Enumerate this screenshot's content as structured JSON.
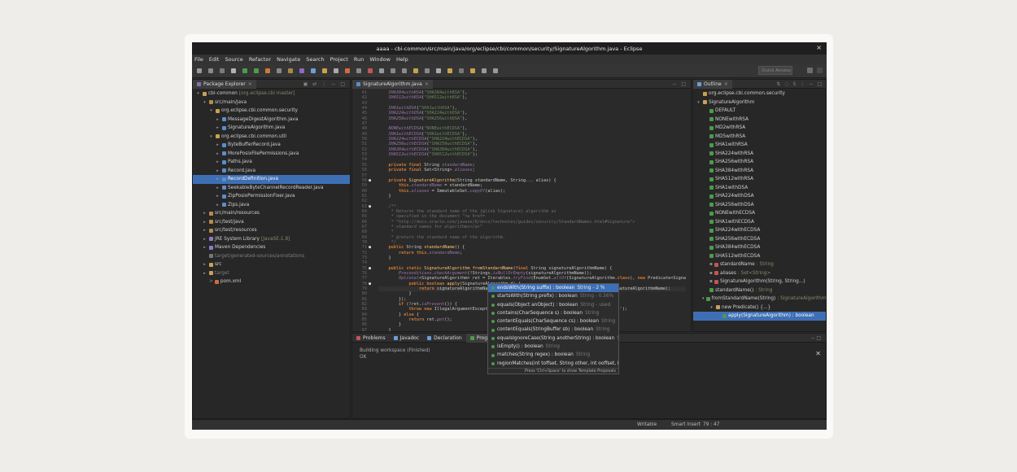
{
  "window_title": "aaaa - cbi-common/src/main/java/org/eclipse/cbi/common/security/SignatureAlgorithm.java - Eclipse",
  "menu": [
    "File",
    "Edit",
    "Source",
    "Refactor",
    "Navigate",
    "Search",
    "Project",
    "Run",
    "Window",
    "Help"
  ],
  "quick_access": "Quick Access",
  "package_explorer": {
    "tab": "Package Explorer",
    "items": [
      {
        "label": "cbi-common",
        "deco": "[org.eclipse.cbi master]",
        "indent": 0,
        "arrow": "▾",
        "icon": "#c9a05a"
      },
      {
        "label": "src/main/java",
        "indent": 1,
        "arrow": "▾",
        "icon": "#b58b4c"
      },
      {
        "label": "org.eclipse.cbi.common.security",
        "indent": 2,
        "arrow": "▾",
        "icon": "#c8a24a"
      },
      {
        "label": "MessageDigestAlgorithm.java",
        "indent": 3,
        "arrow": "▸",
        "icon": "#5b8ec9"
      },
      {
        "label": "SignatureAlgorithm.java",
        "indent": 3,
        "arrow": "▸",
        "icon": "#5b8ec9"
      },
      {
        "label": "org.eclipse.cbi.common.util",
        "indent": 2,
        "arrow": "▾",
        "icon": "#c8a24a"
      },
      {
        "label": "ByteBufferRecord.java",
        "indent": 3,
        "arrow": "▸",
        "icon": "#5b8ec9"
      },
      {
        "label": "MorePosixFilePermissions.java",
        "indent": 3,
        "arrow": "▸",
        "icon": "#5b8ec9"
      },
      {
        "label": "Paths.java",
        "indent": 3,
        "arrow": "▸",
        "icon": "#5b8ec9"
      },
      {
        "label": "Record.java",
        "indent": 3,
        "arrow": "▸",
        "icon": "#5b8ec9"
      },
      {
        "label": "RecordDefinition.java",
        "indent": 3,
        "arrow": "▸",
        "icon": "#5b8ec9",
        "selected": true
      },
      {
        "label": "SeekableByteChannelRecordReader.java",
        "indent": 3,
        "arrow": "▸",
        "icon": "#5b8ec9"
      },
      {
        "label": "ZipPosixPermissionFixer.java",
        "indent": 3,
        "arrow": "▸",
        "icon": "#5b8ec9"
      },
      {
        "label": "Zips.java",
        "indent": 3,
        "arrow": "▸",
        "icon": "#5b8ec9"
      },
      {
        "label": "src/main/resources",
        "indent": 1,
        "arrow": "▸",
        "icon": "#b58b4c"
      },
      {
        "label": "src/test/java",
        "indent": 1,
        "arrow": "▸",
        "icon": "#b58b4c"
      },
      {
        "label": "src/test/resources",
        "indent": 1,
        "arrow": "▸",
        "icon": "#b58b4c"
      },
      {
        "label": "JRE System Library",
        "deco": "[JavaSE-1.8]",
        "indent": 1,
        "arrow": "▸",
        "icon": "#8a7cc2"
      },
      {
        "label": "Maven Dependencies",
        "indent": 1,
        "arrow": "▸",
        "icon": "#8a7cc2"
      },
      {
        "label": "target/generated-sources/annotations",
        "indent": 1,
        "arrow": "",
        "icon": "#777",
        "dim": true
      },
      {
        "label": "src",
        "indent": 1,
        "arrow": "▸",
        "icon": "#c9a05a"
      },
      {
        "label": "target",
        "indent": 1,
        "arrow": "▸",
        "icon": "#c9a05a",
        "dim": true
      },
      {
        "label": "pom.xml",
        "indent": 1,
        "arrow": "",
        "icon": "#d26b3c",
        "prefix": "> "
      }
    ]
  },
  "editor": {
    "tab": "SignatureAlgorithm.java",
    "lines": [
      {
        "n": "41",
        "h": "\t<span class=\"f\">SHA384withRSA</span>(<span class=\"s\">\"SHA384withRSA\"</span>),"
      },
      {
        "n": "42",
        "h": "\t<span class=\"f\">SHA512withRSA</span>(<span class=\"s\">\"SHA512withRSA\"</span>),"
      },
      {
        "n": "43",
        "h": ""
      },
      {
        "n": "44",
        "h": "\t<span class=\"f\">SHA1withDSA</span>(<span class=\"s\">\"SHA1withDSA\"</span>),"
      },
      {
        "n": "45",
        "h": "\t<span class=\"f\">SHA224withDSA</span>(<span class=\"s\">\"SHA224withDSA\"</span>),"
      },
      {
        "n": "46",
        "h": "\t<span class=\"f\">SHA256withDSA</span>(<span class=\"s\">\"SHA256withDSA\"</span>),"
      },
      {
        "n": "47",
        "h": ""
      },
      {
        "n": "48",
        "h": "\t<span class=\"f\">NONEwithECDSA</span>(<span class=\"s\">\"NONEwithECDSA\"</span>),"
      },
      {
        "n": "49",
        "h": "\t<span class=\"f\">SHA1withECDSA</span>(<span class=\"s\">\"SHA1withECDSA\"</span>),"
      },
      {
        "n": "50",
        "h": "\t<span class=\"f\">SHA224withECDSA</span>(<span class=\"s\">\"SHA224withECDSA\"</span>),"
      },
      {
        "n": "51",
        "h": "\t<span class=\"f\">SHA256withECDSA</span>(<span class=\"s\">\"SHA256withECDSA\"</span>),"
      },
      {
        "n": "52",
        "h": "\t<span class=\"f\">SHA384withECDSA</span>(<span class=\"s\">\"SHA384withECDSA\"</span>),"
      },
      {
        "n": "53",
        "h": "\t<span class=\"f\">SHA512withECDSA</span>(<span class=\"s\">\"SHA512withECDSA\"</span>);"
      },
      {
        "n": "54",
        "h": ""
      },
      {
        "n": "55",
        "h": "\t<span class=\"k\">private final</span> String <span class=\"f\">standardName</span>;"
      },
      {
        "n": "56",
        "h": "\t<span class=\"k\">private final</span> Set&lt;String&gt; <span class=\"f\">aliases</span>;"
      },
      {
        "n": "57",
        "h": ""
      },
      {
        "n": "58",
        "h": "\t<span class=\"k\">private</span> <span class=\"m\">SignatureAlgorithm</span>(String standardName, String... alias) {",
        "o": "●"
      },
      {
        "n": "59",
        "h": "\t\t<span class=\"k\">this</span>.<span class=\"f\">standardName</span> = standardName;"
      },
      {
        "n": "60",
        "h": "\t\t<span class=\"k\">this</span>.<span class=\"f\">aliases</span> = ImmutableSet.<span class=\"f\">copyOf</span>(alias);"
      },
      {
        "n": "61",
        "h": "\t}"
      },
      {
        "n": "62",
        "h": ""
      },
      {
        "n": "63",
        "h": "\t<span class=\"c\">/**</span>",
        "o": "●"
      },
      {
        "n": "64",
        "h": "<span class=\"c\">\t * Returns the standard name of the {@link Signature} algorithm as</span>"
      },
      {
        "n": "65",
        "h": "<span class=\"c\">\t * specified in the document \"&lt;a href=</span>"
      },
      {
        "n": "66",
        "h": "<span class=\"c\">\t * \"http://docs.oracle.com/javase/8/docs/technotes/guides/security/StandardNames.html#Signature\"&gt;</span>"
      },
      {
        "n": "67",
        "h": "<span class=\"c\">\t * standard names for algorithms&lt;/a&gt;\"</span>"
      },
      {
        "n": "68",
        "h": "<span class=\"c\">\t *</span>"
      },
      {
        "n": "69",
        "h": "<span class=\"c\">\t * @return the standard name of the algorithm.</span>"
      },
      {
        "n": "70",
        "h": "<span class=\"c\">\t */</span>"
      },
      {
        "n": "71",
        "h": "\t<span class=\"k\">public</span> String <span class=\"m\">standardName</span>() {",
        "o": "●"
      },
      {
        "n": "72",
        "h": "\t\t<span class=\"k\">return this</span>.<span class=\"f\">standardName</span>;"
      },
      {
        "n": "73",
        "h": "\t}"
      },
      {
        "n": "74",
        "h": ""
      },
      {
        "n": "75",
        "h": "\t<span class=\"k\">public static</span> <span class=\"m\">SignatureAlgorithm</span> <span class=\"m\">fromStandardName</span>(<span class=\"k\">final</span> String signatureAlgorithmName) {",
        "o": "●"
      },
      {
        "n": "76",
        "h": "\t\t<span class=\"f\">Preconditions</span>.<span class=\"f\">checkArgument</span>(!Strings.<span class=\"f\">isNullOrEmpty</span>(signatureAlgorithmName));"
      },
      {
        "n": "77",
        "h": "\t\t<span class=\"f\">Optional</span>&lt;SignatureAlgorithm&gt; ret = Iterables.<span class=\"f\">tryFind</span>(EnumSet.<span class=\"f\">allOf</span>(SignatureAlgorithm.<span class=\"k\">class</span>), <span class=\"k\">new</span> Predicate&lt;Signa"
      },
      {
        "n": "78",
        "h": "\t\t\t<span class=\"k\">public boolean</span> <span class=\"m\">apply</span>(SignatureAlgorithm d) {",
        "o": "●"
      },
      {
        "n": "79",
        "h": "\t\t\t\t<span class=\"k\">return</span> signatureAlgorithmName.<span class=\"cur\">equals</span>(d.<span class=\"f\">standardName</span>) || d.<span class=\"f\">aliases</span>.<span class=\"f\">contains</span>(signatureAlgorithmName);",
        "cur": true
      },
      {
        "n": "80",
        "h": "\t\t\t}"
      },
      {
        "n": "81",
        "h": "\t\t});"
      },
      {
        "n": "82",
        "h": "\t\t<span class=\"k\">if</span> (!ret.<span class=\"f\">isPresent</span>()) {"
      },
      {
        "n": "83",
        "h": "\t\t\t<span class=\"k\">throw new</span> IllegalArgumentException(                                    thmName + <span class=\"s\">\"'\"</span>);"
      },
      {
        "n": "84",
        "h": "\t\t} <span class=\"k\">else</span> {"
      },
      {
        "n": "85",
        "h": "\t\t\t<span class=\"k\">return</span> ret.<span class=\"f\">get</span>();"
      },
      {
        "n": "86",
        "h": "\t\t}"
      },
      {
        "n": "87",
        "h": "\t}"
      },
      {
        "n": "88",
        "h": "}"
      },
      {
        "n": "89",
        "h": ""
      }
    ]
  },
  "completion": {
    "items": [
      {
        "sig": "endsWith(String suffix) : boolean",
        "type": "String - 2 %",
        "selected": true
      },
      {
        "sig": "startsWith(String prefix) : boolean",
        "type": "String - 0.56%"
      },
      {
        "sig": "equals(Object anObject) : boolean",
        "type": "String - used"
      },
      {
        "sig": "contains(CharSequence s) : boolean",
        "type": "String"
      },
      {
        "sig": "contentEquals(CharSequence cs) : boolean",
        "type": "String"
      },
      {
        "sig": "contentEquals(StringBuffer sb) : boolean",
        "type": "String"
      },
      {
        "sig": "equalsIgnoreCase(String anotherString) : boolean",
        "type": "String"
      },
      {
        "sig": "isEmpty() : boolean",
        "type": "String"
      },
      {
        "sig": "matches(String regex) : boolean",
        "type": "String"
      },
      {
        "sig": "regionMatches(int toffset, String other, int ooffset, int len)",
        "type": ""
      }
    ],
    "footer": "Press 'Ctrl+Space' to show Template Proposals"
  },
  "outline": {
    "tab": "Outline",
    "items": [
      {
        "label": "org.eclipse.cbi.common.security",
        "indent": 0,
        "icon": "#c8a24a"
      },
      {
        "label": "SignatureAlgorithm",
        "indent": 0,
        "arrow": "▾",
        "icon": "#c9a05a"
      },
      {
        "label": "DEFAULT",
        "indent": 1,
        "icon": "#4c9a4c"
      },
      {
        "label": "NONEwithRSA",
        "indent": 1,
        "icon": "#4c9a4c"
      },
      {
        "label": "MD2withRSA",
        "indent": 1,
        "icon": "#4c9a4c"
      },
      {
        "label": "MD5withRSA",
        "indent": 1,
        "icon": "#4c9a4c"
      },
      {
        "label": "SHA1withRSA",
        "indent": 1,
        "icon": "#4c9a4c"
      },
      {
        "label": "SHA224withRSA",
        "indent": 1,
        "icon": "#4c9a4c"
      },
      {
        "label": "SHA256withRSA",
        "indent": 1,
        "icon": "#4c9a4c"
      },
      {
        "label": "SHA384withRSA",
        "indent": 1,
        "icon": "#4c9a4c"
      },
      {
        "label": "SHA512withRSA",
        "indent": 1,
        "icon": "#4c9a4c"
      },
      {
        "label": "SHA1withDSA",
        "indent": 1,
        "icon": "#4c9a4c"
      },
      {
        "label": "SHA224withDSA",
        "indent": 1,
        "icon": "#4c9a4c"
      },
      {
        "label": "SHA256withDSA",
        "indent": 1,
        "icon": "#4c9a4c"
      },
      {
        "label": "NONEwithECDSA",
        "indent": 1,
        "icon": "#4c9a4c"
      },
      {
        "label": "SHA1withECDSA",
        "indent": 1,
        "icon": "#4c9a4c"
      },
      {
        "label": "SHA224withECDSA",
        "indent": 1,
        "icon": "#4c9a4c"
      },
      {
        "label": "SHA256withECDSA",
        "indent": 1,
        "icon": "#4c9a4c"
      },
      {
        "label": "SHA384withECDSA",
        "indent": 1,
        "icon": "#4c9a4c"
      },
      {
        "label": "SHA512withECDSA",
        "indent": 1,
        "icon": "#4c9a4c"
      },
      {
        "label": "standardName",
        "type": ": String",
        "indent": 1,
        "icon": "#c45555",
        "prefix": "▪ "
      },
      {
        "label": "aliases",
        "type": ": Set<String>",
        "indent": 1,
        "icon": "#c45555",
        "prefix": "▪ "
      },
      {
        "label": "SignatureAlgorithm(String, String...)",
        "indent": 1,
        "icon": "#c45555",
        "prefix": "▪ "
      },
      {
        "label": "standardName()",
        "type": ": String",
        "indent": 1,
        "icon": "#4c9a4c"
      },
      {
        "label": "fromStandardName(String)",
        "type": ": SignatureAlgorithm",
        "indent": 1,
        "arrow": "▾",
        "icon": "#4c9a4c"
      },
      {
        "label": "new Predicate() {...}",
        "indent": 2,
        "arrow": "▾",
        "icon": "#c9a05a"
      },
      {
        "label": "apply(SignatureAlgorithm) : boolean",
        "indent": 3,
        "icon": "#4c9a4c",
        "selected": true
      }
    ]
  },
  "bottom": {
    "tabs": [
      "Problems",
      "Javadoc",
      "Declaration",
      "Progress"
    ],
    "active": "Progress",
    "line1": "Building workspace (Finished)",
    "line2": "OK"
  },
  "status": {
    "writable": "Writable",
    "insert": "Smart Insert",
    "pos": "79 : 47"
  }
}
